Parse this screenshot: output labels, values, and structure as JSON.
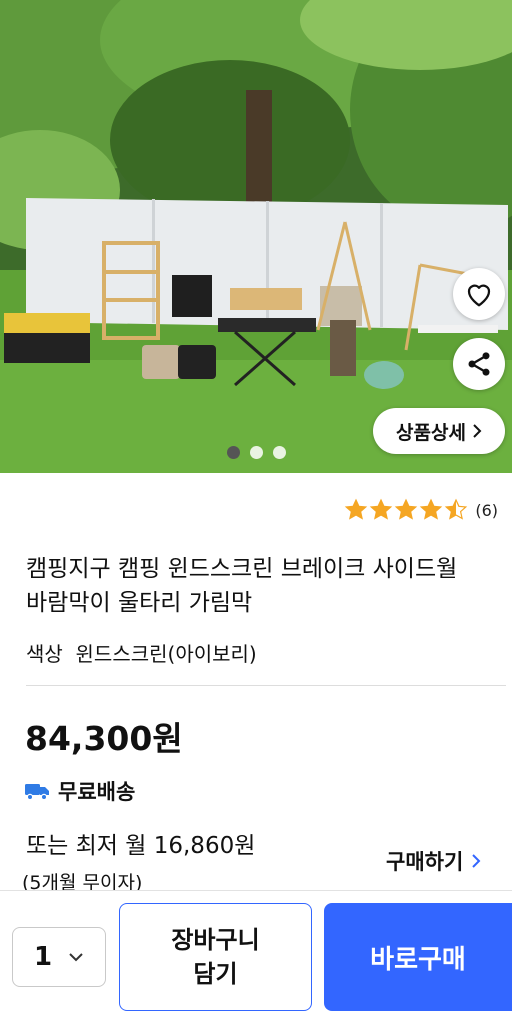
{
  "product": {
    "title": "캠핑지구 캠핑 윈드스크린 브레이크 사이드월 바람막이 울타리 가림막",
    "option_label": "색상",
    "option_value": "윈드스크린(아이보리)",
    "price": "84,300원",
    "shipping": "무료배송",
    "installment": "또는 최저 월 16,860원",
    "installment_sub": "(5개월 무이자)",
    "buy_link": "구매하기",
    "rating": {
      "value": 4.5,
      "max": 5,
      "count": "(6)"
    }
  },
  "image": {
    "detail_button": "상품상세",
    "carousel": {
      "total": 3,
      "active": 1
    }
  },
  "icons": {
    "favorite": "heart-icon",
    "share": "share-icon",
    "shipping": "truck-icon",
    "chevron": "chevron-right-icon",
    "quantity_dropdown": "chevron-down-icon"
  },
  "bottom_bar": {
    "quantity": "1",
    "cart_button": "장바구니\n담기",
    "buy_button": "바로구매"
  },
  "colors": {
    "accent": "#3366ff",
    "star": "#f5a623",
    "shipping_icon": "#2f7be5"
  }
}
